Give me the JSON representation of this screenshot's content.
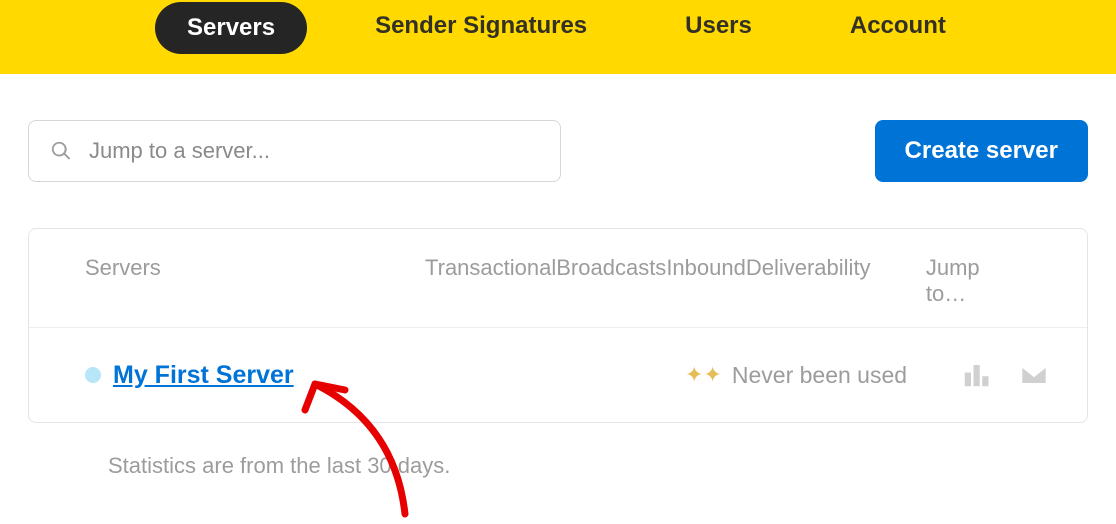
{
  "nav": {
    "items": [
      {
        "label": "Servers",
        "active": true
      },
      {
        "label": "Sender Signatures"
      },
      {
        "label": "Users"
      },
      {
        "label": "Account"
      }
    ]
  },
  "search": {
    "placeholder": "Jump to a server..."
  },
  "create_button": "Create server",
  "columns": {
    "servers": "Servers",
    "transactional": "Transactional",
    "broadcasts": "Broadcasts",
    "inbound": "Inbound",
    "deliverability": "Deliverability",
    "jump": "Jump to…"
  },
  "rows": [
    {
      "name": "My First Server",
      "deliverability": "Never been used",
      "color": "#b6e6f7"
    }
  ],
  "footer": "Statistics are from the last 30 days."
}
